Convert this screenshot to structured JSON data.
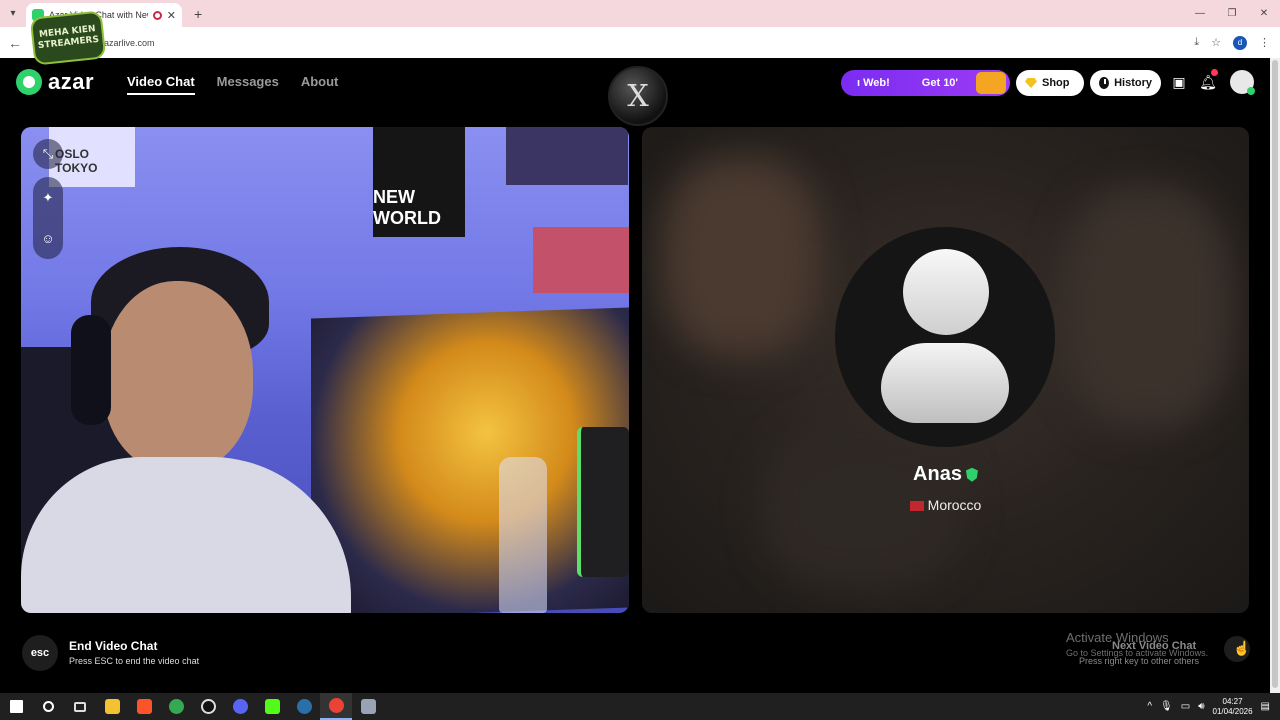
{
  "browser": {
    "tab_title": "Azar Video Chat with New",
    "url": "azarlive.com",
    "profile_initial": "d"
  },
  "overlay": {
    "logo_text": "MEHA KIEN STREAMERS"
  },
  "header": {
    "logo": "azar",
    "nav": [
      {
        "label": "Video Chat",
        "active": true
      },
      {
        "label": "Messages",
        "active": false
      },
      {
        "label": "About",
        "active": false
      }
    ],
    "center_logo": "X",
    "promo_left": "ı Web!",
    "promo_right": "Get 10'",
    "shop_label": "Shop",
    "history_label": "History",
    "notification_badge": "1"
  },
  "self_panel": {
    "banner_text": "OSLO TOKYO",
    "poster_text": "NEW WORLD"
  },
  "peer": {
    "name": "Anas",
    "country": "Morocco"
  },
  "bottom": {
    "esc_label": "esc",
    "end_title": "End Video Chat",
    "end_subtitle": "Press ESC to end the video chat",
    "next_title": "Next Video Chat",
    "next_subtitle": "Press right key to other others",
    "activate_title": "Activate Windows",
    "activate_subtitle": "Go to Settings to activate Windows."
  },
  "taskbar": {
    "time": "04:27",
    "date": "01/04/2026"
  },
  "colors": {
    "accent_green": "#2fd16d",
    "promo_purple": "#7b2cf2",
    "tab_bar": "#f5d7de"
  }
}
